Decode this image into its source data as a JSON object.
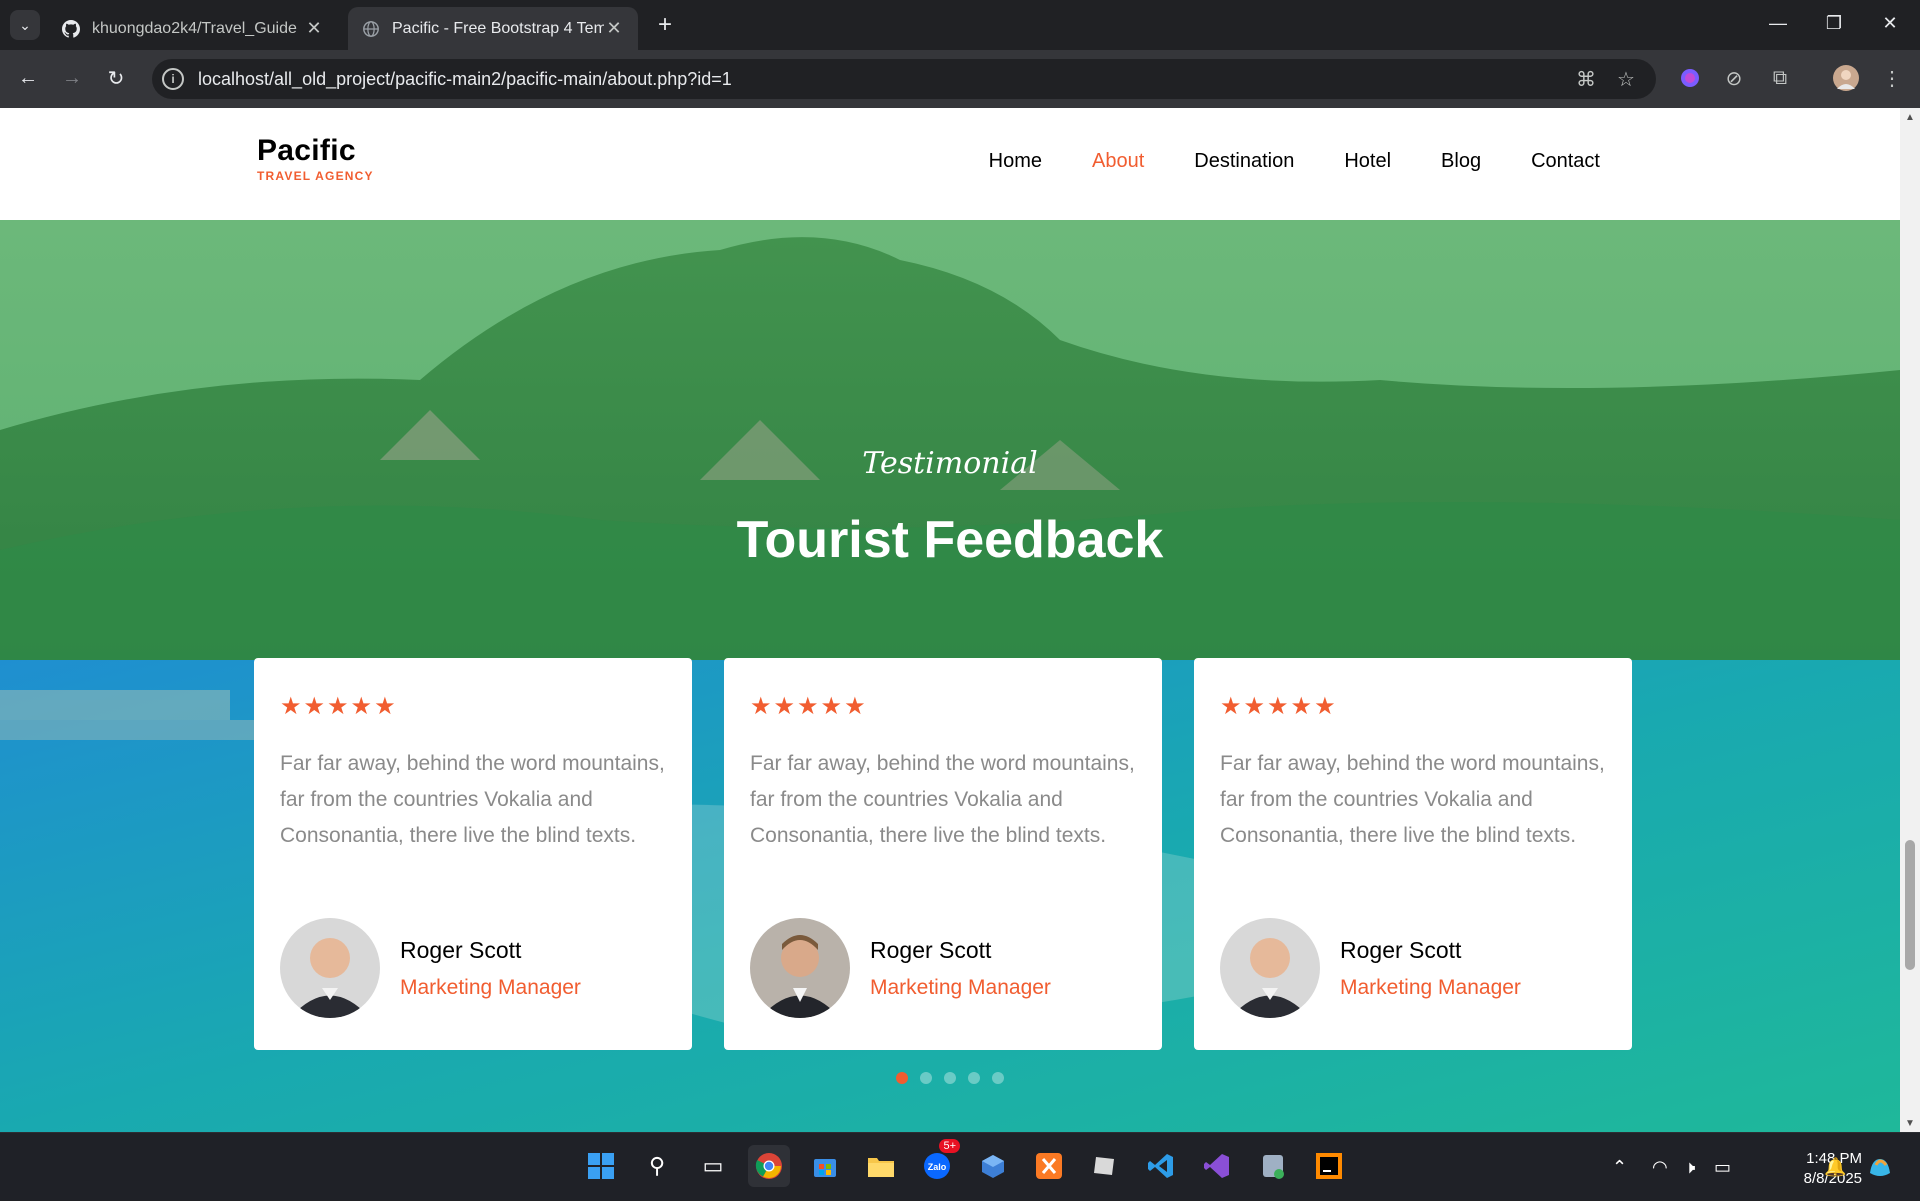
{
  "browser": {
    "tabs": [
      {
        "title": "khuongdao2k4/Travel_Guide",
        "active": false,
        "icon": "github-icon"
      },
      {
        "title": "Pacific - Free Bootstrap 4 Templ",
        "active": true,
        "icon": "globe-icon"
      }
    ],
    "url": "localhost/all_old_project/pacific-main2/pacific-main/about.php?id=1"
  },
  "site": {
    "brand": {
      "name": "Pacific",
      "tagline": "TRAVEL AGENCY"
    },
    "menu": [
      {
        "label": "Home",
        "active": false
      },
      {
        "label": "About",
        "active": true
      },
      {
        "label": "Destination",
        "active": false
      },
      {
        "label": "Hotel",
        "active": false
      },
      {
        "label": "Blog",
        "active": false
      },
      {
        "label": "Contact",
        "active": false
      }
    ],
    "accent": "#f15d30"
  },
  "testimonial": {
    "subheading": "Testimonial",
    "heading": "Tourist Feedback",
    "cards": [
      {
        "stars": "★★★★★",
        "rating": 5,
        "quote": "Far far away, behind the word mountains, far from the countries Vokalia and Consonantia, there live the blind texts.",
        "name": "Roger Scott",
        "position": "Marketing Manager"
      },
      {
        "stars": "★★★★★",
        "rating": 5,
        "quote": "Far far away, behind the word mountains, far from the countries Vokalia and Consonantia, there live the blind texts.",
        "name": "Roger Scott",
        "position": "Marketing Manager"
      },
      {
        "stars": "★★★★★",
        "rating": 5,
        "quote": "Far far away, behind the word mountains, far from the countries Vokalia and Consonantia, there live the blind texts.",
        "name": "Roger Scott",
        "position": "Marketing Manager"
      }
    ],
    "carousel_active": 1,
    "carousel_count": 5
  },
  "taskbar": {
    "zalo_badge": "5+",
    "time": "1:48 PM",
    "date": "8/8/2025"
  }
}
